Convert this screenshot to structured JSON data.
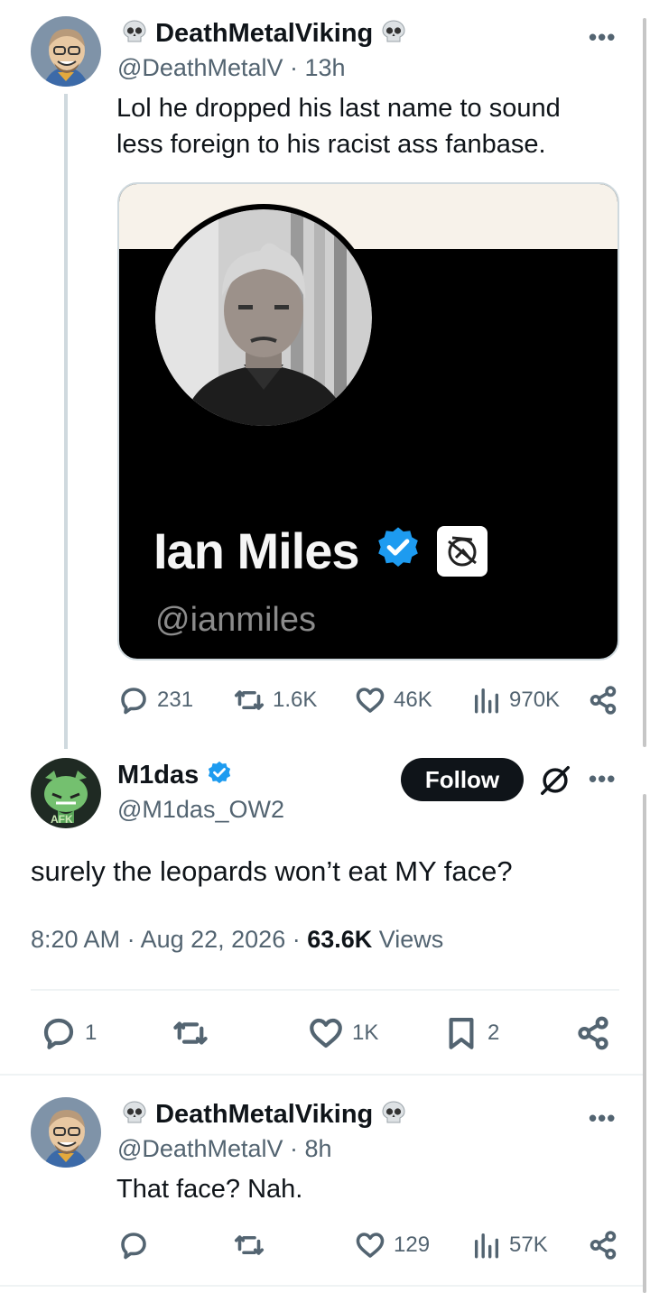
{
  "post1": {
    "author_name": "DeathMetalViking",
    "handle": "@DeathMetalV · 13h",
    "text_line1": "Lol he dropped his last name to sound",
    "text_line2": "less foreign to his racist ass fanbase.",
    "card": {
      "profile_name": "Ian Miles",
      "profile_handle": "@ianmiles"
    },
    "stats": {
      "replies": "231",
      "reposts": "1.6K",
      "likes": "46K",
      "views": "970K"
    }
  },
  "post2": {
    "author_name": "M1das",
    "handle": "@M1das_OW2",
    "follow_label": "Follow",
    "text": "surely the leopards won’t eat MY face?",
    "time": "8:20 AM · Aug 22, 2026 · ",
    "views_count": "63.6K",
    "views_label": " Views",
    "stats": {
      "replies": "1",
      "likes": "1K",
      "bookmarks": "2"
    }
  },
  "post3": {
    "author_name": "DeathMetalViking",
    "handle": "@DeathMetalV · 8h",
    "text": "That face? Nah.",
    "stats": {
      "likes": "129",
      "views": "57K"
    }
  },
  "more_label": "•••",
  "colors": {
    "verified": "#1d9bf0",
    "text": "#0f1419",
    "secondary": "#536471",
    "card_bg": "#000000",
    "card_band": "#f7f2ea"
  }
}
